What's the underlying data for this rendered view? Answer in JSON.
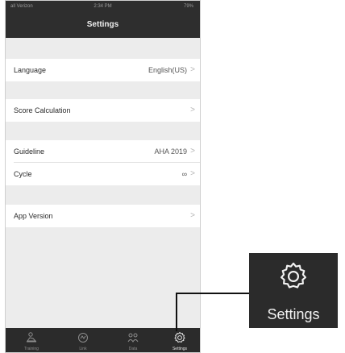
{
  "status_bar": {
    "carrier": "all Verizon",
    "time": "2:34 PM",
    "battery": "79%"
  },
  "nav_title": "Settings",
  "settings": {
    "language": {
      "label": "Language",
      "value": "English(US)"
    },
    "score_calculation": {
      "label": "Score Calculation",
      "value": ""
    },
    "guideline": {
      "label": "Guideline",
      "value": "AHA 2019"
    },
    "cycle": {
      "label": "Cycle",
      "value": "∞"
    },
    "app_version": {
      "label": "App Version",
      "value": ""
    }
  },
  "chevron": ">",
  "tabs": [
    {
      "label": "Training",
      "icon": "training-icon"
    },
    {
      "label": "Link",
      "icon": "link-icon"
    },
    {
      "label": "Data",
      "icon": "data-icon"
    },
    {
      "label": "Settings",
      "icon": "gear-icon",
      "active": true
    }
  ],
  "callout": {
    "label": "Settings",
    "icon": "gear-icon"
  },
  "colors": {
    "bar_background": "#2e2e2e",
    "page_background": "#ececec",
    "row_background": "#ffffff"
  }
}
